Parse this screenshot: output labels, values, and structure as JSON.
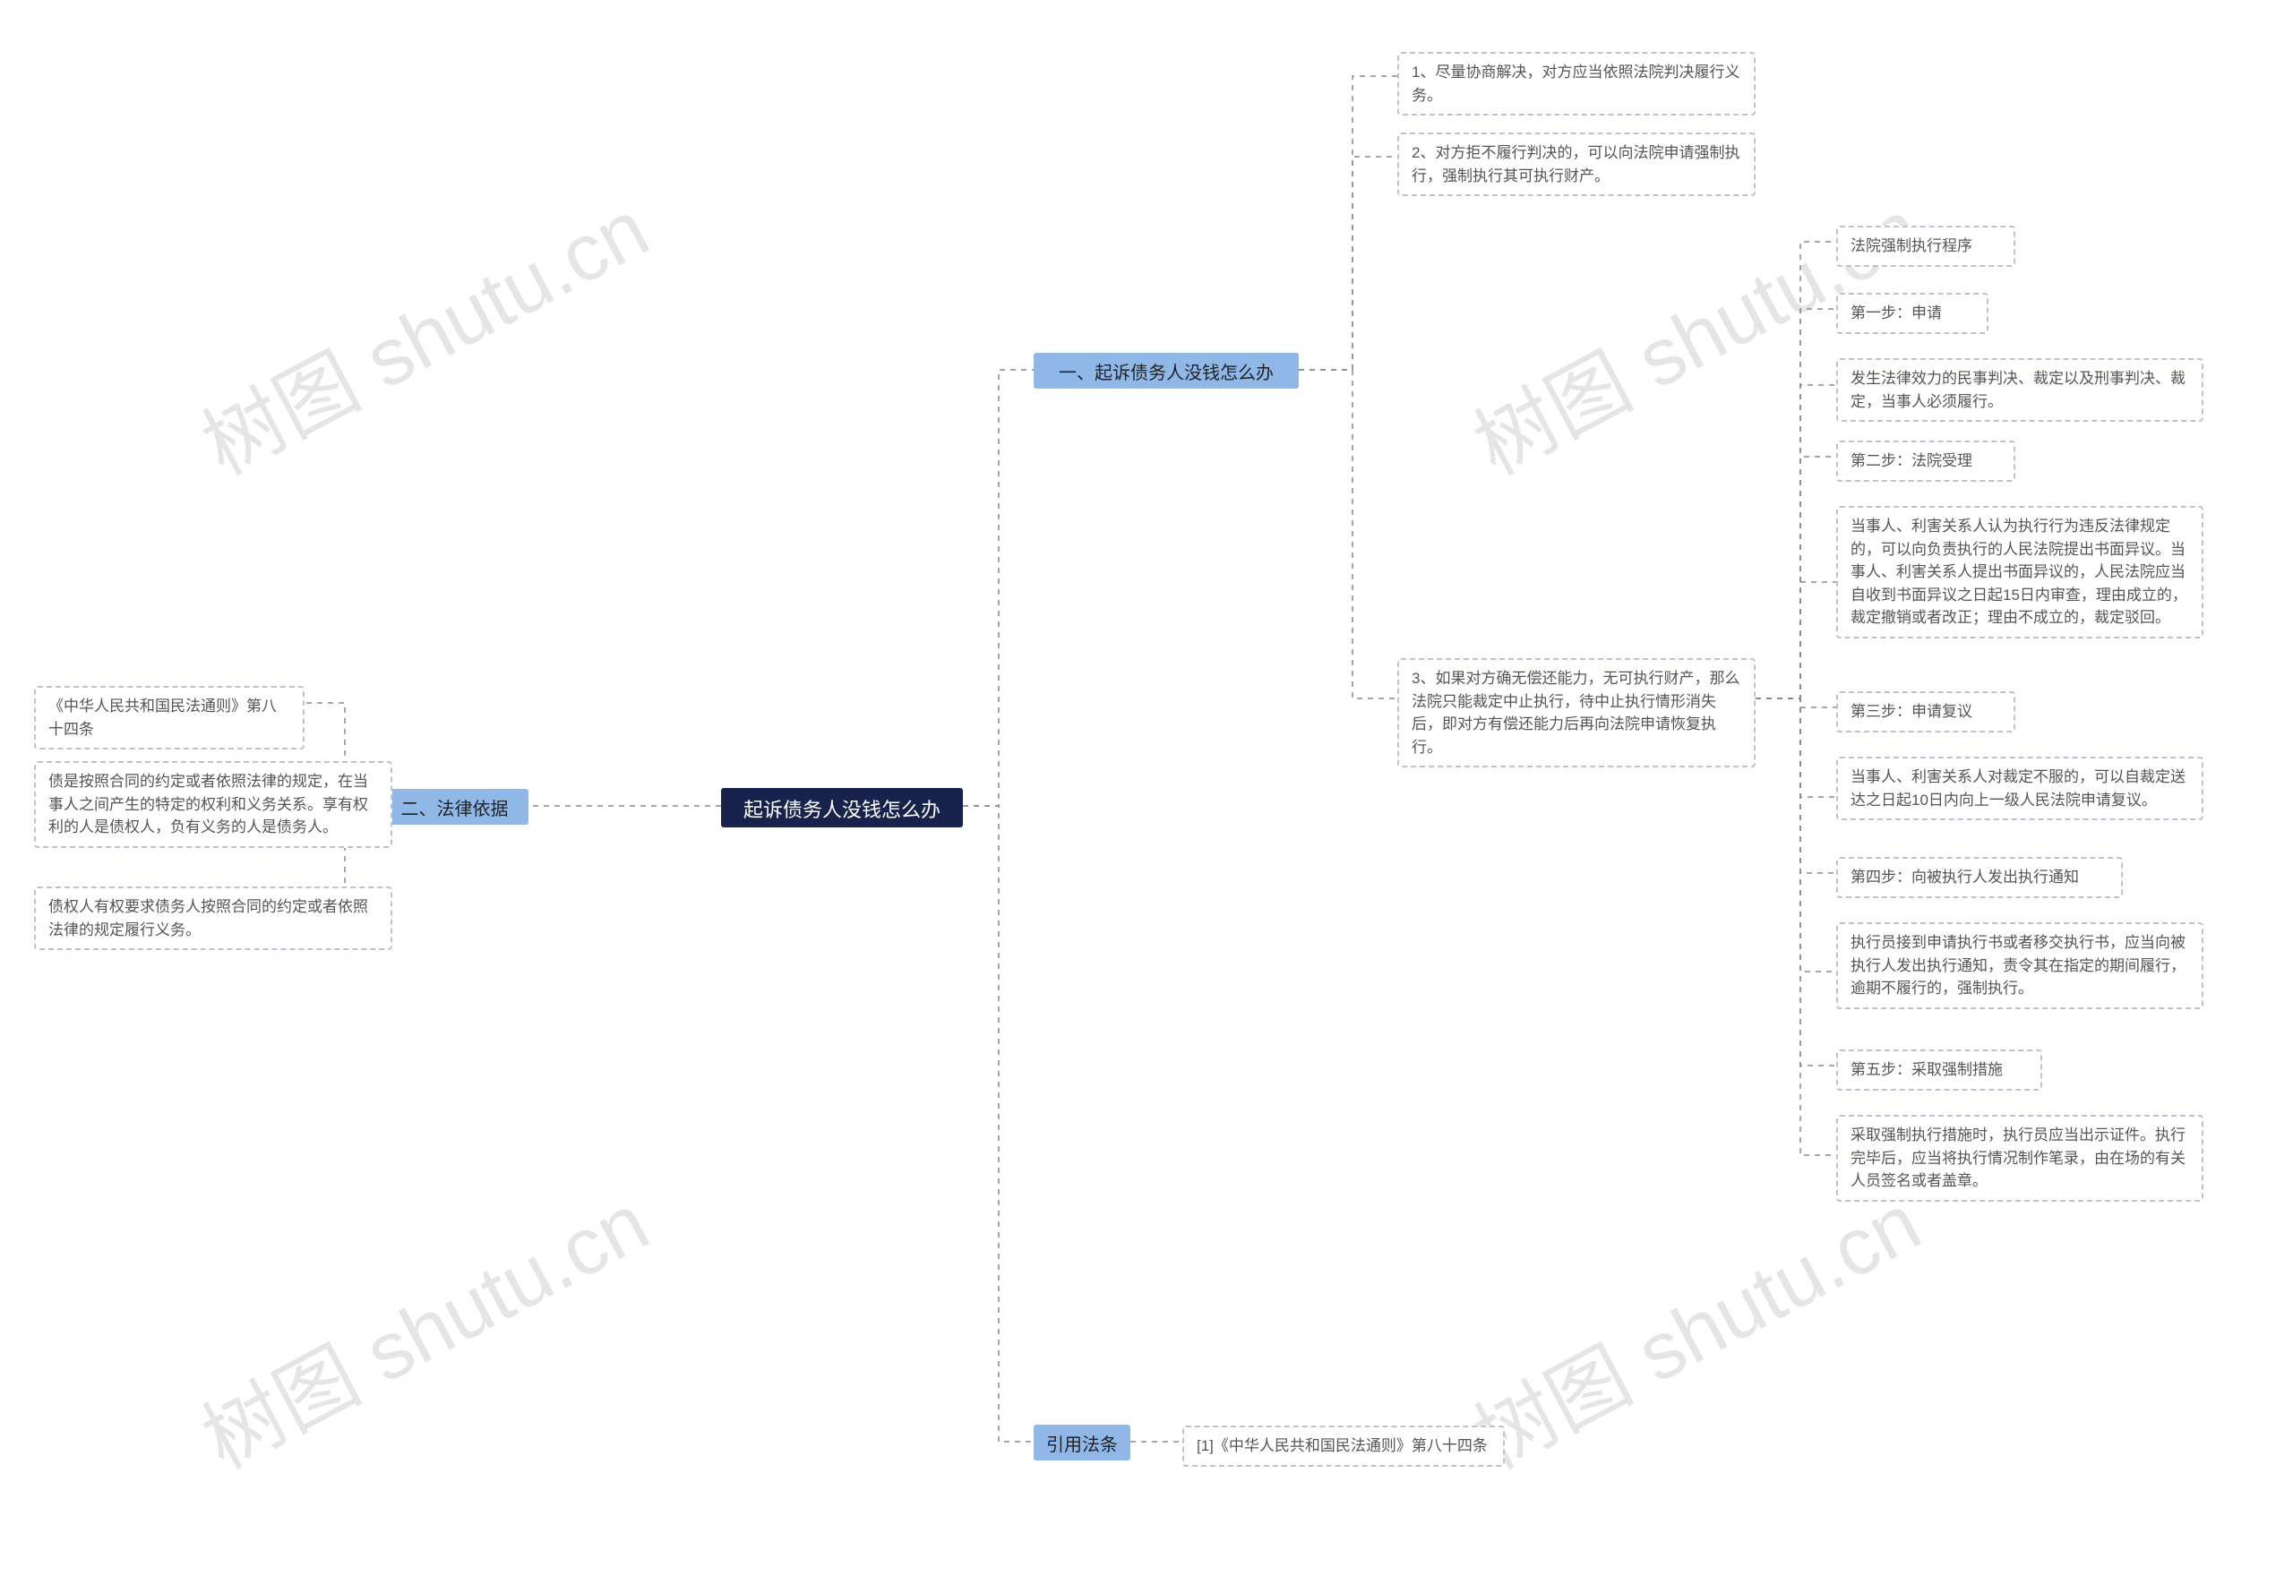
{
  "watermark_text": "树图 shutu.cn",
  "root": {
    "title": "起诉债务人没钱怎么办"
  },
  "branches": {
    "one": {
      "label": "一、起诉债务人没钱怎么办",
      "items": {
        "i1": "1、尽量协商解决，对方应当依照法院判决履行义务。",
        "i2": "2、对方拒不履行判决的，可以向法院申请强制执行，强制执行其可执行财产。",
        "i3": "3、如果对方确无偿还能力，无可执行财产，那么法院只能裁定中止执行，待中止执行情形消失后，即对方有偿还能力后再向法院申请恢复执行。",
        "steps": {
          "s0": "法院强制执行程序",
          "s1": "第一步：申请",
          "s1d": "发生法律效力的民事判决、裁定以及刑事判决、裁定，当事人必须履行。",
          "s2": "第二步：法院受理",
          "s2d": "当事人、利害关系人认为执行行为违反法律规定的，可以向负责执行的人民法院提出书面异议。当事人、利害关系人提出书面异议的，人民法院应当自收到书面异议之日起15日内审查，理由成立的，裁定撤销或者改正；理由不成立的，裁定驳回。",
          "s3": "第三步：申请复议",
          "s3d": "当事人、利害关系人对裁定不服的，可以自裁定送达之日起10日内向上一级人民法院申请复议。",
          "s4": "第四步：向被执行人发出执行通知",
          "s4d": "执行员接到申请执行书或者移交执行书，应当向被执行人发出执行通知，责令其在指定的期间履行，逾期不履行的，强制执行。",
          "s5": "第五步：采取强制措施",
          "s5d": "采取强制执行措施时，执行员应当出示证件。执行完毕后，应当将执行情况制作笔录，由在场的有关人员签名或者盖章。"
        }
      }
    },
    "two": {
      "label": "二、法律依据",
      "items": {
        "l1": "《中华人民共和国民法通则》第八十四条",
        "l2": "债是按照合同的约定或者依照法律的规定，在当事人之间产生的特定的权利和义务关系。享有权利的人是债权人，负有义务的人是债务人。",
        "l3": "债权人有权要求债务人按照合同的约定或者依照法律的规定履行义务。"
      }
    },
    "ref": {
      "label": "引用法条",
      "items": {
        "r1": "[1]《中华人民共和国民法通则》第八十四条"
      }
    }
  }
}
